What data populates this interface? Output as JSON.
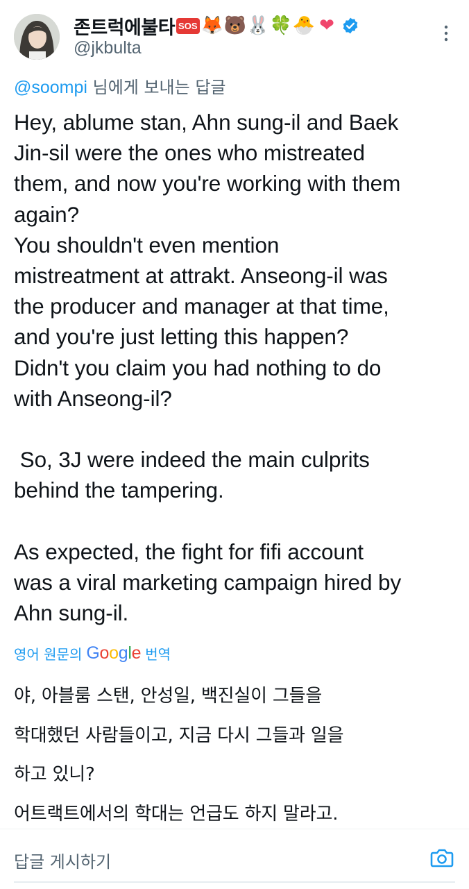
{
  "author": {
    "display_name": "존트럭에불타",
    "handle": "@jkbulta",
    "badge_text": "SOS",
    "emojis": [
      "🦊",
      "🐻",
      "🐰",
      "🍀",
      "🐣",
      "❤"
    ],
    "verified_icon": "verified-badge-icon",
    "accent_color": "#1d9bf0"
  },
  "reply_context": {
    "mention": "@soompi",
    "suffix": " 님에게 보내는 답글"
  },
  "tweet": {
    "text": "Hey, ablume stan, Ahn sung-il and Baek\nJin-sil were the ones who mistreated\nthem, and now you're working with them\nagain?\nYou shouldn't even mention\nmistreatment at attrakt. Anseong-il was\nthe producer and manager at that time,\nand you're just letting this happen?\nDidn't you claim you had nothing to do\nwith Anseong-il?\n\n So, 3J were indeed the main culprits\nbehind the tampering.\n\nAs expected, the fight for fifi account\nwas a viral marketing campaign hired by\nAhn sung-il."
  },
  "translation": {
    "label_prefix": "영어 원문의",
    "provider_letters": [
      "G",
      "o",
      "o",
      "g",
      "l",
      "e"
    ],
    "label_suffix": "번역",
    "text": "야, 아블룸 스탠, 안성일, 백진실이 그들을\n학대했던 사람들이고, 지금 다시 그들과 일을\n하고 있니?\n어트랙트에서의 학대는 언급도 하지 말라고."
  },
  "reply_bar": {
    "placeholder": "답글 게시하기",
    "camera_icon": "camera-icon"
  }
}
